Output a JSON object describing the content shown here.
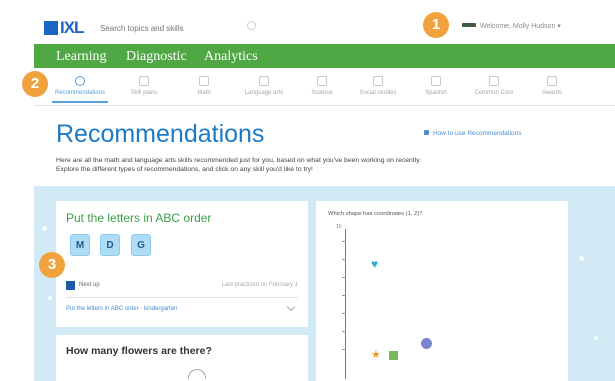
{
  "top_bar": {
    "logo_text": "IXL",
    "search_placeholder": "Search topics and skills",
    "user_label": "Welcome, Molly Hudson ▾"
  },
  "main_nav": {
    "tabs": [
      "Learning",
      "Diagnostic",
      "Analytics"
    ]
  },
  "subject_nav": {
    "tabs": [
      {
        "label": "Recommendations",
        "icon": "recommendations-icon",
        "active": true
      },
      {
        "label": "Skill plans",
        "icon": "skill-plans-icon",
        "active": false
      },
      {
        "label": "Math",
        "icon": "math-icon",
        "active": false
      },
      {
        "label": "Language arts",
        "icon": "language-arts-icon",
        "active": false
      },
      {
        "label": "Science",
        "icon": "science-icon",
        "active": false
      },
      {
        "label": "Social studies",
        "icon": "social-studies-icon",
        "active": false
      },
      {
        "label": "Spanish",
        "icon": "spanish-icon",
        "active": false
      },
      {
        "label": "Common Core",
        "icon": "common-core-icon",
        "active": false
      },
      {
        "label": "Awards",
        "icon": "awards-icon",
        "active": false
      }
    ]
  },
  "header": {
    "title": "Recommendations",
    "link": "How to use Recommendations",
    "description_line1": "Here are all the math and language arts skills recommended just for you, based on what you've been working on recently.",
    "description_line2": "Explore the different types of recommendations, and click on any skill you'd like to try!"
  },
  "card_abc": {
    "title": "Put the letters in ABC order",
    "letters": [
      "M",
      "D",
      "G"
    ],
    "tag": "Next up",
    "practiced": "Last practiced on February 1",
    "skill_link": "Put the letters in ABC order · kindergarten"
  },
  "card_flowers": {
    "title": "How many flowers are there?"
  },
  "card_graph": {
    "question": "Which shape has coordinates (1, 2)?",
    "y_axis_top_label": "10"
  },
  "callouts": [
    "1",
    "2",
    "3"
  ],
  "colors": {
    "nav_green": "#4fa844",
    "title_blue": "#1d7ac5",
    "callout_orange": "#f0a33d",
    "background_blue": "#d2e9f6"
  }
}
